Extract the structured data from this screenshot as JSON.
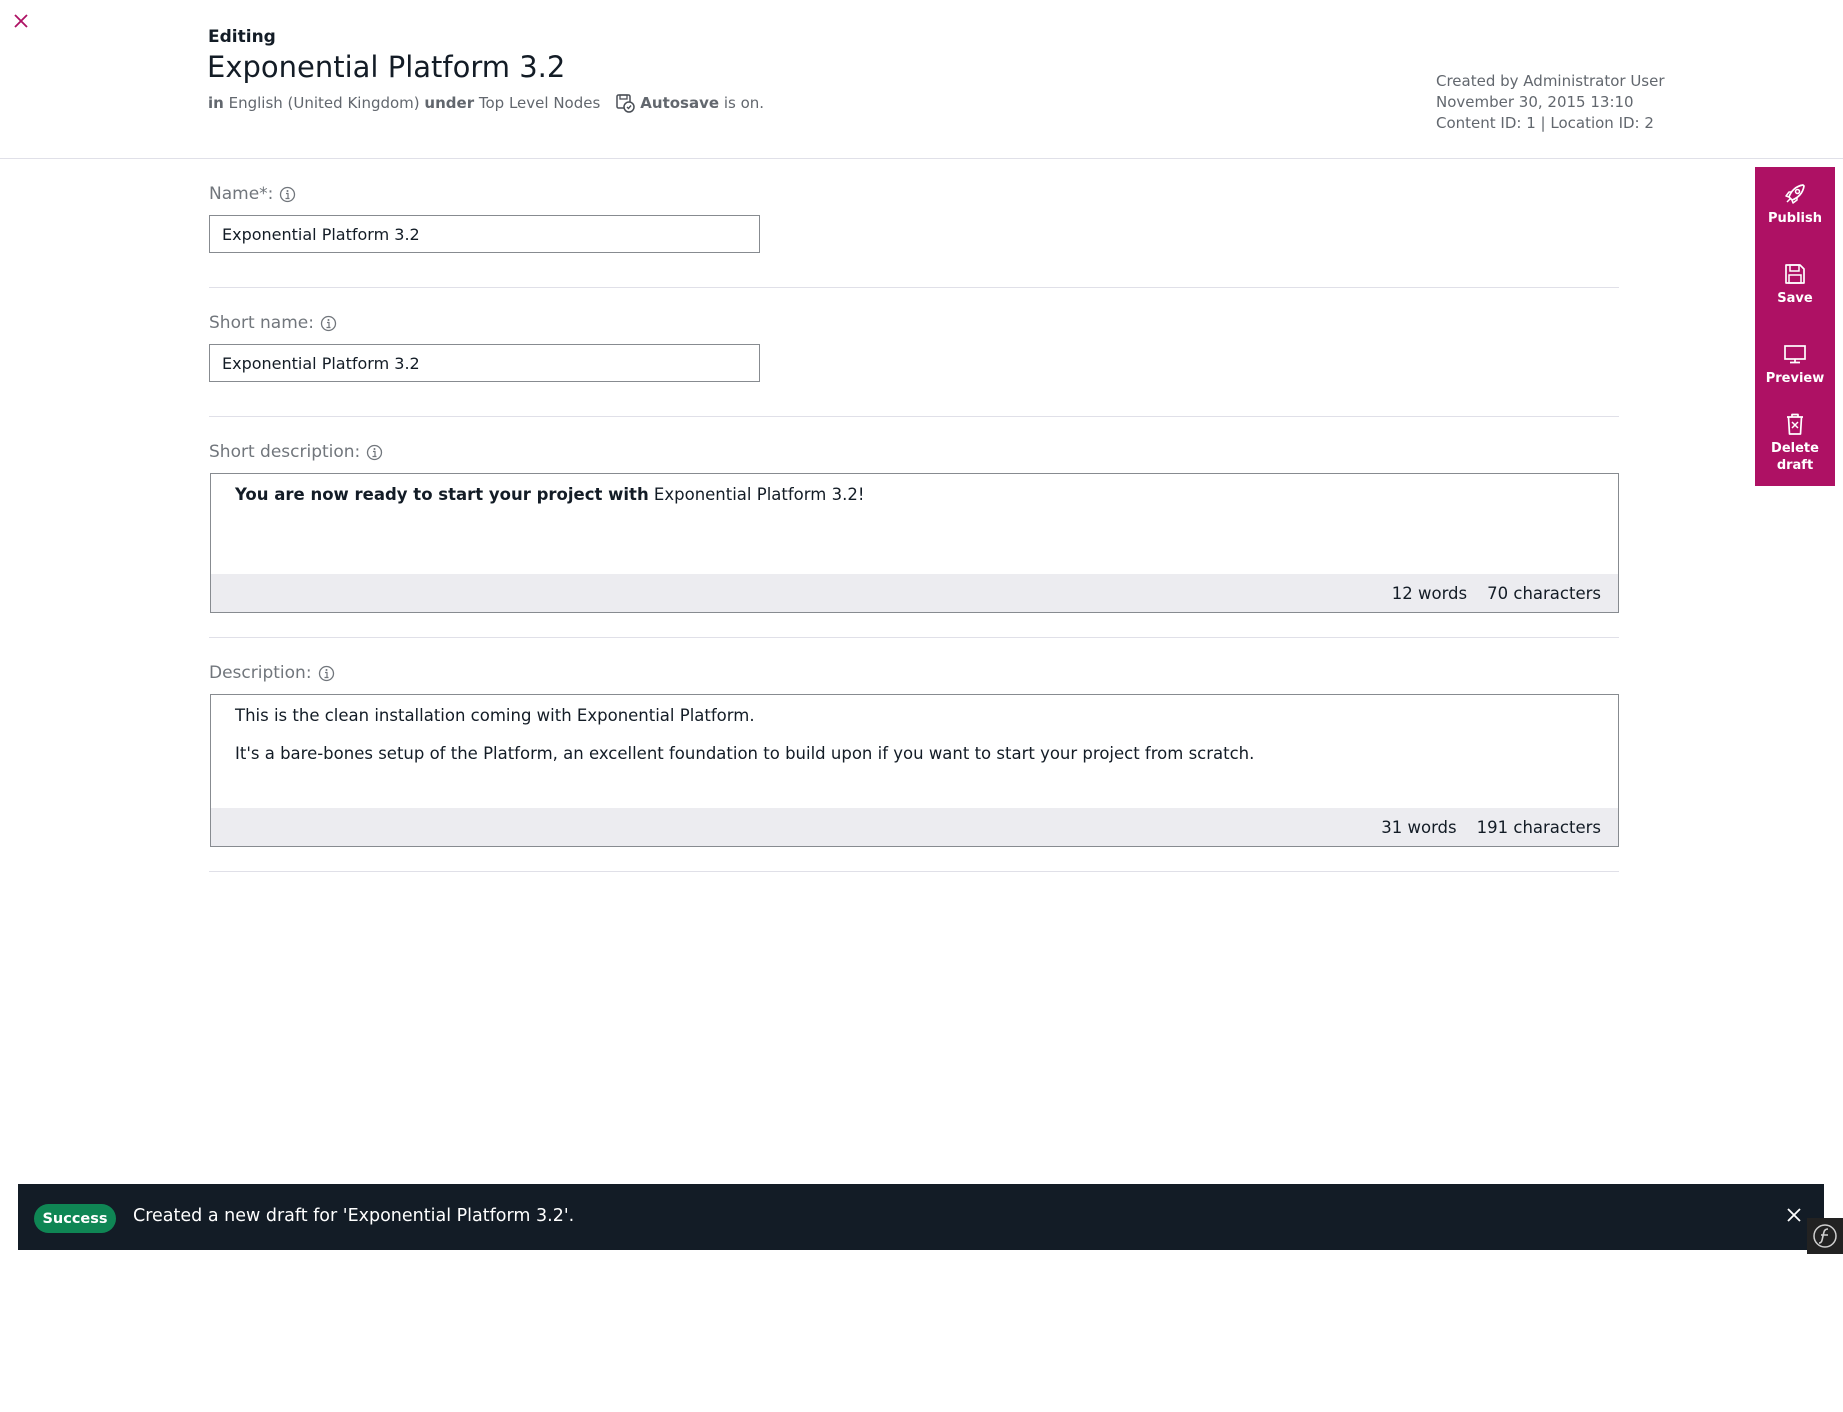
{
  "header": {
    "editing_label": "Editing",
    "title": "Exponential Platform 3.2",
    "in_word": "in",
    "language": "English (United Kingdom)",
    "under_word": "under",
    "location": "Top Level Nodes",
    "autosave_label": "Autosave",
    "autosave_status": "is on.",
    "created_by": "Created by Administrator User",
    "created_date": "November 30, 2015 13:10",
    "ids": "Content ID: 1 | Location ID: 2"
  },
  "form": {
    "name": {
      "label": "Name*:",
      "value": "Exponential Platform 3.2"
    },
    "short_name": {
      "label": "Short name:",
      "value": "Exponential Platform 3.2"
    },
    "short_description": {
      "label": "Short description:",
      "bold_text": "You are now ready to start your project with",
      "text": " Exponential Platform 3.2!",
      "words": "12 words",
      "characters": "70 characters"
    },
    "description": {
      "label": "Description:",
      "paragraph_1": "This is the clean installation coming with Exponential Platform.",
      "paragraph_2": "It's a bare-bones setup of the Platform, an excellent foundation to build upon if you want to start your project from scratch.",
      "words": "31 words",
      "characters": "191 characters"
    }
  },
  "actions": {
    "publish": "Publish",
    "save": "Save",
    "preview": "Preview",
    "delete_line1": "Delete",
    "delete_line2": "draft"
  },
  "notification": {
    "badge": "Success",
    "message": "Created a new draft for 'Exponential Platform 3.2'."
  },
  "colors": {
    "accent": "#ae1164",
    "toast_bg": "#131c26",
    "success": "#0f8654"
  },
  "icons": [
    "close-icon",
    "autosave-icon",
    "info-icon",
    "rocket-icon",
    "floppy-disk-icon",
    "monitor-icon",
    "trash-icon",
    "symfony-icon"
  ]
}
